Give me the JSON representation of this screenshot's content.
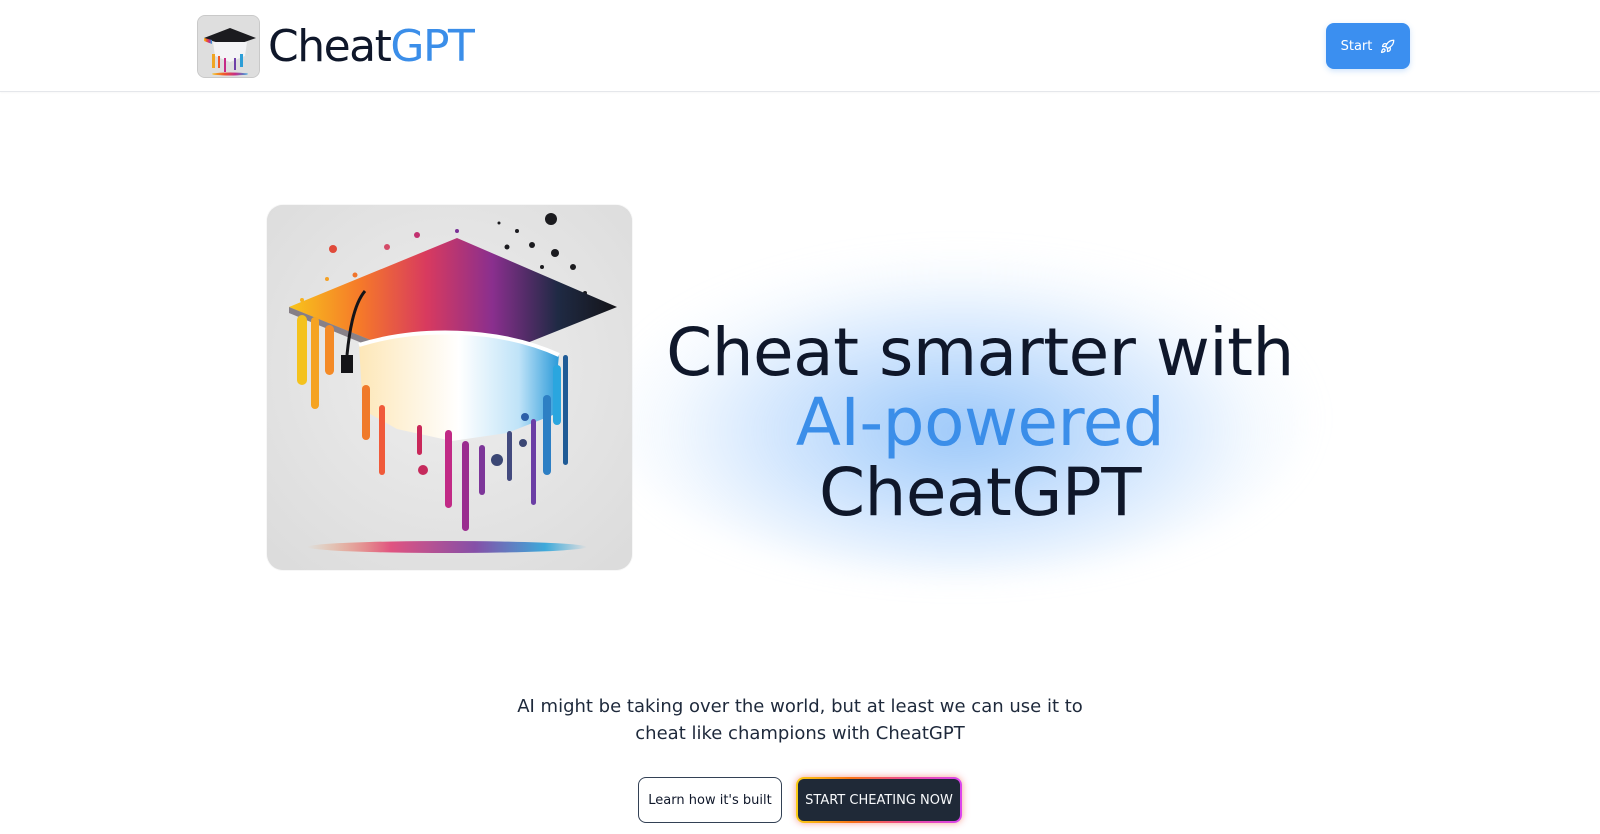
{
  "header": {
    "brand_part1": "Cheat",
    "brand_part2": "GPT",
    "start_label": "Start"
  },
  "hero": {
    "title_line1": "Cheat smarter with",
    "title_accent": "AI-powered",
    "title_rest": " CheatGPT",
    "tagline": "AI might be taking over the world, but at least we can use it to cheat like champions with CheatGPT",
    "learn_label": "Learn how it's built",
    "cta_label": "START CHEATING NOW"
  },
  "colors": {
    "accent": "#3b8ee9",
    "button_blue": "#3b8ff0",
    "dark_button": "#1f2937"
  },
  "icons": {
    "start_button_icon": "rocket-icon",
    "logo_image": "graduation-cap-icon"
  }
}
